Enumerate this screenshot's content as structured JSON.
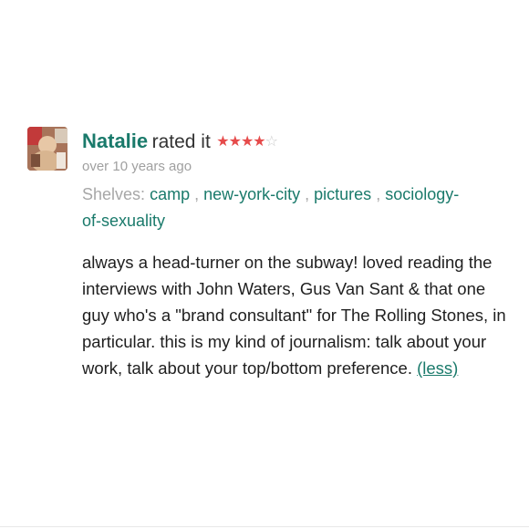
{
  "review": {
    "user_name": "Natalie",
    "rated_text": "rated it",
    "rating": 4,
    "rating_max": 5,
    "time_ago": "over 10 years ago",
    "shelves_label": "Shelves:",
    "shelves": [
      "camp",
      "new-york-city",
      "pictures",
      "sociology-of-sexuality"
    ],
    "body": "always a head-turner on the subway! loved reading the interviews with John Waters, Gus Van Sant & that one guy who's a \"brand consultant\" for The Rolling Stones, in particular. this is my kind of journalism: talk about your work, talk about your top/bottom preference.",
    "less_label": "(less)"
  },
  "colors": {
    "link": "#1a7a6b",
    "star_on": "#e64b4b",
    "star_off": "#c9c9c9",
    "muted": "#a0a0a0"
  }
}
